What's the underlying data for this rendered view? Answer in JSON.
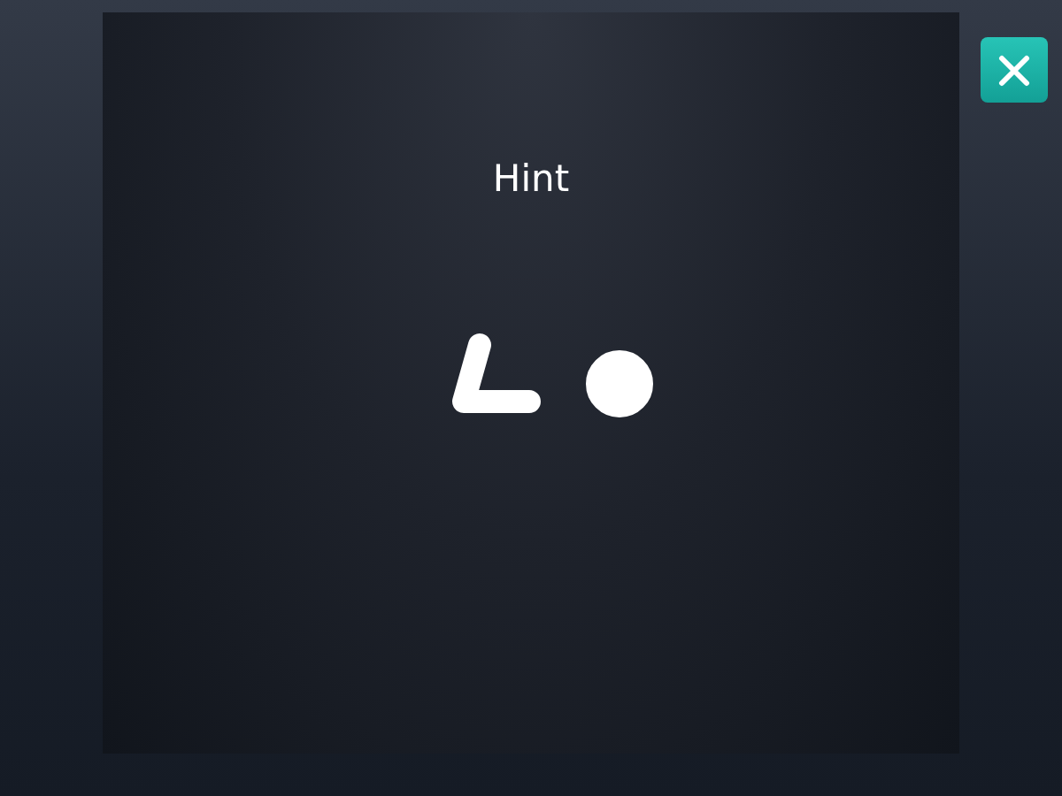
{
  "panel": {
    "title": "Hint"
  }
}
